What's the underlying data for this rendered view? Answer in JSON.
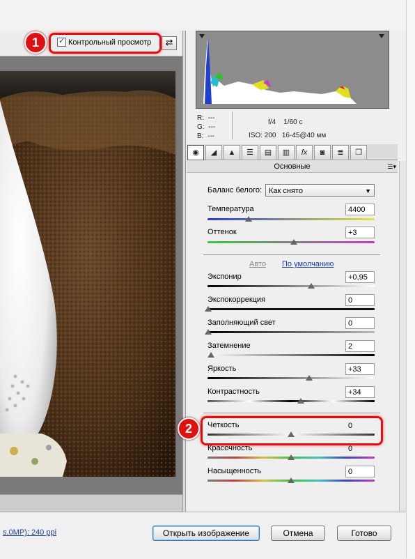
{
  "preview": {
    "label": "Контрольный просмотр",
    "checked": true
  },
  "markers": [
    "1",
    "2"
  ],
  "camera": {
    "r": "R:",
    "r_val": "---",
    "g": "G:",
    "g_val": "---",
    "b": "B:",
    "b_val": "---",
    "aperture": "f/4",
    "shutter": "1/60 с",
    "iso": "ISO: 200",
    "lens": "16-45@40 мм"
  },
  "tabs": [
    "aperture-icon",
    "curve-icon",
    "sharpen-icon",
    "hsl-icon",
    "split-icon",
    "lens-icon",
    "fx-icon",
    "camera-icon",
    "presets-icon",
    "snapshots-icon"
  ],
  "panel_title": "Основные",
  "white_balance": {
    "label": "Баланс белого:",
    "value": "Как снято"
  },
  "sliders_top": [
    {
      "label": "Температура",
      "value": "4400",
      "pos": 0.24,
      "colors": "#2a3bd8,#e8e838"
    },
    {
      "label": "Оттенок",
      "value": "+3",
      "pos": 0.51,
      "colors": "#3ac83a,#c83ac8"
    }
  ],
  "links": {
    "auto": "Авто",
    "default": "По умолчанию"
  },
  "sliders_mid": [
    {
      "label": "Экспонир",
      "value": "+0,95",
      "pos": 0.62
    },
    {
      "label": "Экспокоррекция",
      "value": "0",
      "pos": 0.0
    },
    {
      "label": "Заполняющий свет",
      "value": "0",
      "pos": 0.0
    },
    {
      "label": "Затемнение",
      "value": "2",
      "pos": 0.02
    },
    {
      "label": "Яркость",
      "value": "+33",
      "pos": 0.61
    },
    {
      "label": "Контрастность",
      "value": "+34",
      "pos": 0.55
    }
  ],
  "sliders_bottom": [
    {
      "label": "Четкость",
      "value": "0",
      "pos": 0.5
    },
    {
      "label": "Красочность",
      "value": "0",
      "pos": 0.5
    },
    {
      "label": "Насыщенность",
      "value": "0",
      "pos": 0.5
    }
  ],
  "footer": {
    "info": "s,0MP); 240 ppi",
    "open": "Открыть изображение",
    "cancel": "Отмена",
    "done": "Готово"
  }
}
